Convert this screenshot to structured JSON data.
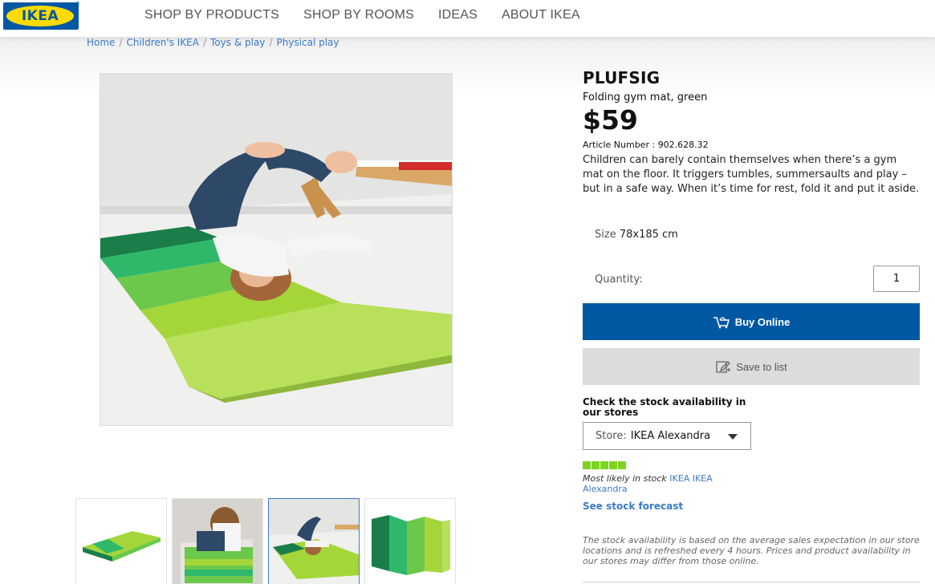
{
  "brand": {
    "logo_text": "IKEA",
    "colors": {
      "blue": "#0058a3",
      "yellow": "#ffdb00",
      "link": "#3a7bc8",
      "stock_green": "#7ed321"
    }
  },
  "nav": {
    "items": [
      "SHOP BY PRODUCTS",
      "SHOP BY ROOMS",
      "IDEAS",
      "ABOUT IKEA"
    ]
  },
  "breadcrumb": {
    "items": [
      "Home",
      "Children's IKEA",
      "Toys & play",
      "Physical play"
    ],
    "separator": "/"
  },
  "product": {
    "name": "PLUFSIG",
    "subtitle": "Folding gym mat, green",
    "price": "$59",
    "article_label": "Article Number :",
    "article_number": "902.628.32",
    "description": "Children can barely contain themselves when there’s a gym mat on the floor. It triggers tumbles, summersaults and play – but in a safe way. When it’s time for rest, fold it and put it aside.",
    "size_label": "Size",
    "size_value": "78x185 cm"
  },
  "purchase": {
    "quantity_label": "Quantity:",
    "quantity_value": "1",
    "buy_label": "Buy Online",
    "buy_icon": "cart-icon",
    "save_label": "Save to list",
    "save_icon": "edit-list-icon"
  },
  "stock": {
    "title": "Check the stock availability in our stores",
    "store_label": "Store:",
    "store_value": "IKEA Alexandra",
    "level": 5,
    "level_max": 5,
    "message": "Most likely in stock",
    "store_link": "IKEA IKEA Alexandra",
    "forecast_label": "See stock forecast",
    "disclaimer": "The stock availability is based on the average sales expectation in our store locations and is refreshed every 4 hours. Prices and product availability in our stores may differ from those online."
  },
  "gallery": {
    "selected_index": 2,
    "thumbnail_count": 4
  }
}
